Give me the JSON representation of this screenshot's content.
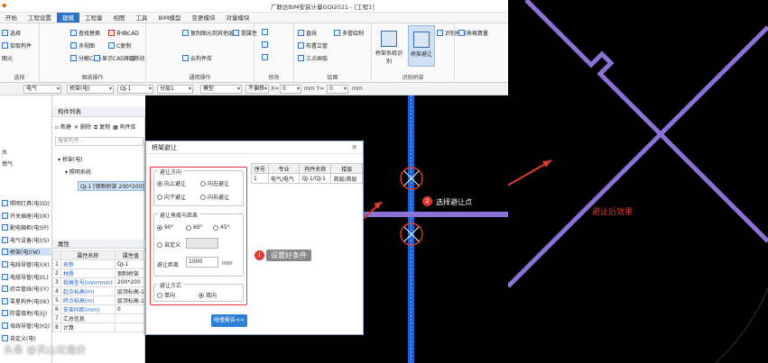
{
  "titlebar": {
    "app_title": "广联达BIM安装计量GQI2021 - [工程1]"
  },
  "menu_tabs": [
    "开始",
    "工程设置",
    "建模",
    "工程量",
    "视图",
    "工具",
    "BIM模型",
    "变更模块",
    "对量模块"
  ],
  "active_tab_index": 2,
  "ribbon": {
    "groups": [
      {
        "name": "选择",
        "buttons": [
          "选择",
          "拾取构件",
          "图元"
        ]
      },
      {
        "name": "图纸操作",
        "buttons": [
          "查找替换",
          "补画CAD",
          "多视图",
          "C复制",
          "分解CAD",
          "显示CAD图层",
          "C移动"
        ]
      },
      {
        "name": "通用操作",
        "buttons": [
          "复制图元到其他层",
          "提属性",
          "云构件库"
        ]
      },
      {
        "name": "修改",
        "buttons": []
      },
      {
        "name": "绘图",
        "buttons": [
          "直线",
          "多管绘制",
          "布置立管",
          "三点画弧"
        ]
      },
      {
        "name": "识别桥架",
        "buttons": [
          "桥架系统识别",
          "桥架避让",
          "识别桥架"
        ]
      },
      {
        "name": "表格算量",
        "buttons": [
          "表格算量"
        ]
      }
    ]
  },
  "propbar": {
    "discipline": "电气",
    "type": "桥架(电)",
    "component": "QJ-1",
    "layer": "分层1",
    "mode": "模型",
    "offset": "不偏移",
    "x_label": "X=",
    "x_value": "0",
    "y_label": "mm Y=",
    "y_value": "0",
    "unit": "mm"
  },
  "nav": {
    "top_items": [
      "水",
      "燃气"
    ],
    "items": [
      "照明灯具(电)(D)",
      "开关插座(电)(K)",
      "配电箱柜(电)(P)",
      "电气设备(电)(S)",
      "桥架(电)(W)",
      "电线导管(电)(X)",
      "电缆导管(电)(L)",
      "综合管线(电)(Y)",
      "零星构件(电)(K)",
      "防雷接地(电)(J)",
      "母线导管(电)(Q)",
      "自定义(电)"
    ],
    "selected_index": 4
  },
  "component_list": {
    "title": "构件列表",
    "tools": [
      "新建",
      "删除",
      "复制",
      "构件库"
    ],
    "search_placeholder": "搜索构件...",
    "tree": {
      "root": "桥架(电)",
      "child": "照明系统",
      "leaf": "QJ-1 [钢制桥架 200*200]"
    }
  },
  "properties": {
    "title": "属性",
    "headers": [
      "",
      "属性名称",
      "属性值"
    ],
    "rows": [
      [
        "1",
        "名称",
        "QJ-1"
      ],
      [
        "2",
        "材质",
        "钢制桥架"
      ],
      [
        "3",
        "规格型号(mm*mm)",
        "200*200"
      ],
      [
        "4",
        "起点标高(m)",
        "层顶标高-1"
      ],
      [
        "5",
        "终点标高(m)",
        "层顶标高-1"
      ],
      [
        "6",
        "支架间距(mm)",
        "0"
      ],
      [
        "7",
        "汇总信息",
        ""
      ],
      [
        "8",
        "计算",
        ""
      ]
    ]
  },
  "dialog": {
    "title": "桥架避让",
    "direction_legend": "避让方向",
    "direction_options": [
      "向上避让",
      "向左避让",
      "向下避让",
      "向右避让"
    ],
    "direction_selected": 0,
    "angle_legend": "避让角度与距离",
    "angle_options": [
      "90°",
      "60°",
      "45°"
    ],
    "angle_selected": 0,
    "custom_label": "自定义",
    "distance_label": "避让距离",
    "distance_value": "1000",
    "distance_unit": "mm",
    "mode_legend": "避让方式",
    "mode_options": [
      "单向",
      "双向"
    ],
    "mode_selected": 1,
    "report_button": "碰撞报告<<",
    "report_headers": [
      "序号",
      "专业",
      "构件名称",
      "楼层"
    ],
    "report_rows": [
      [
        "1",
        "电气/电气",
        "QJ-1/QJ-1",
        "首层/首层"
      ]
    ]
  },
  "annotations": {
    "step1_number": "1",
    "step1_text": "设置好条件",
    "step2_number": "2",
    "step2_text": "选择避让点",
    "result_text": "避让后效果"
  },
  "watermark": "头条 @天山论造价",
  "colors": {
    "accent": "#2b73c8",
    "highlight_red": "#e03b2f",
    "bridge_purple": "#8b72d6",
    "bridge_blue": "#1b5fd0"
  }
}
